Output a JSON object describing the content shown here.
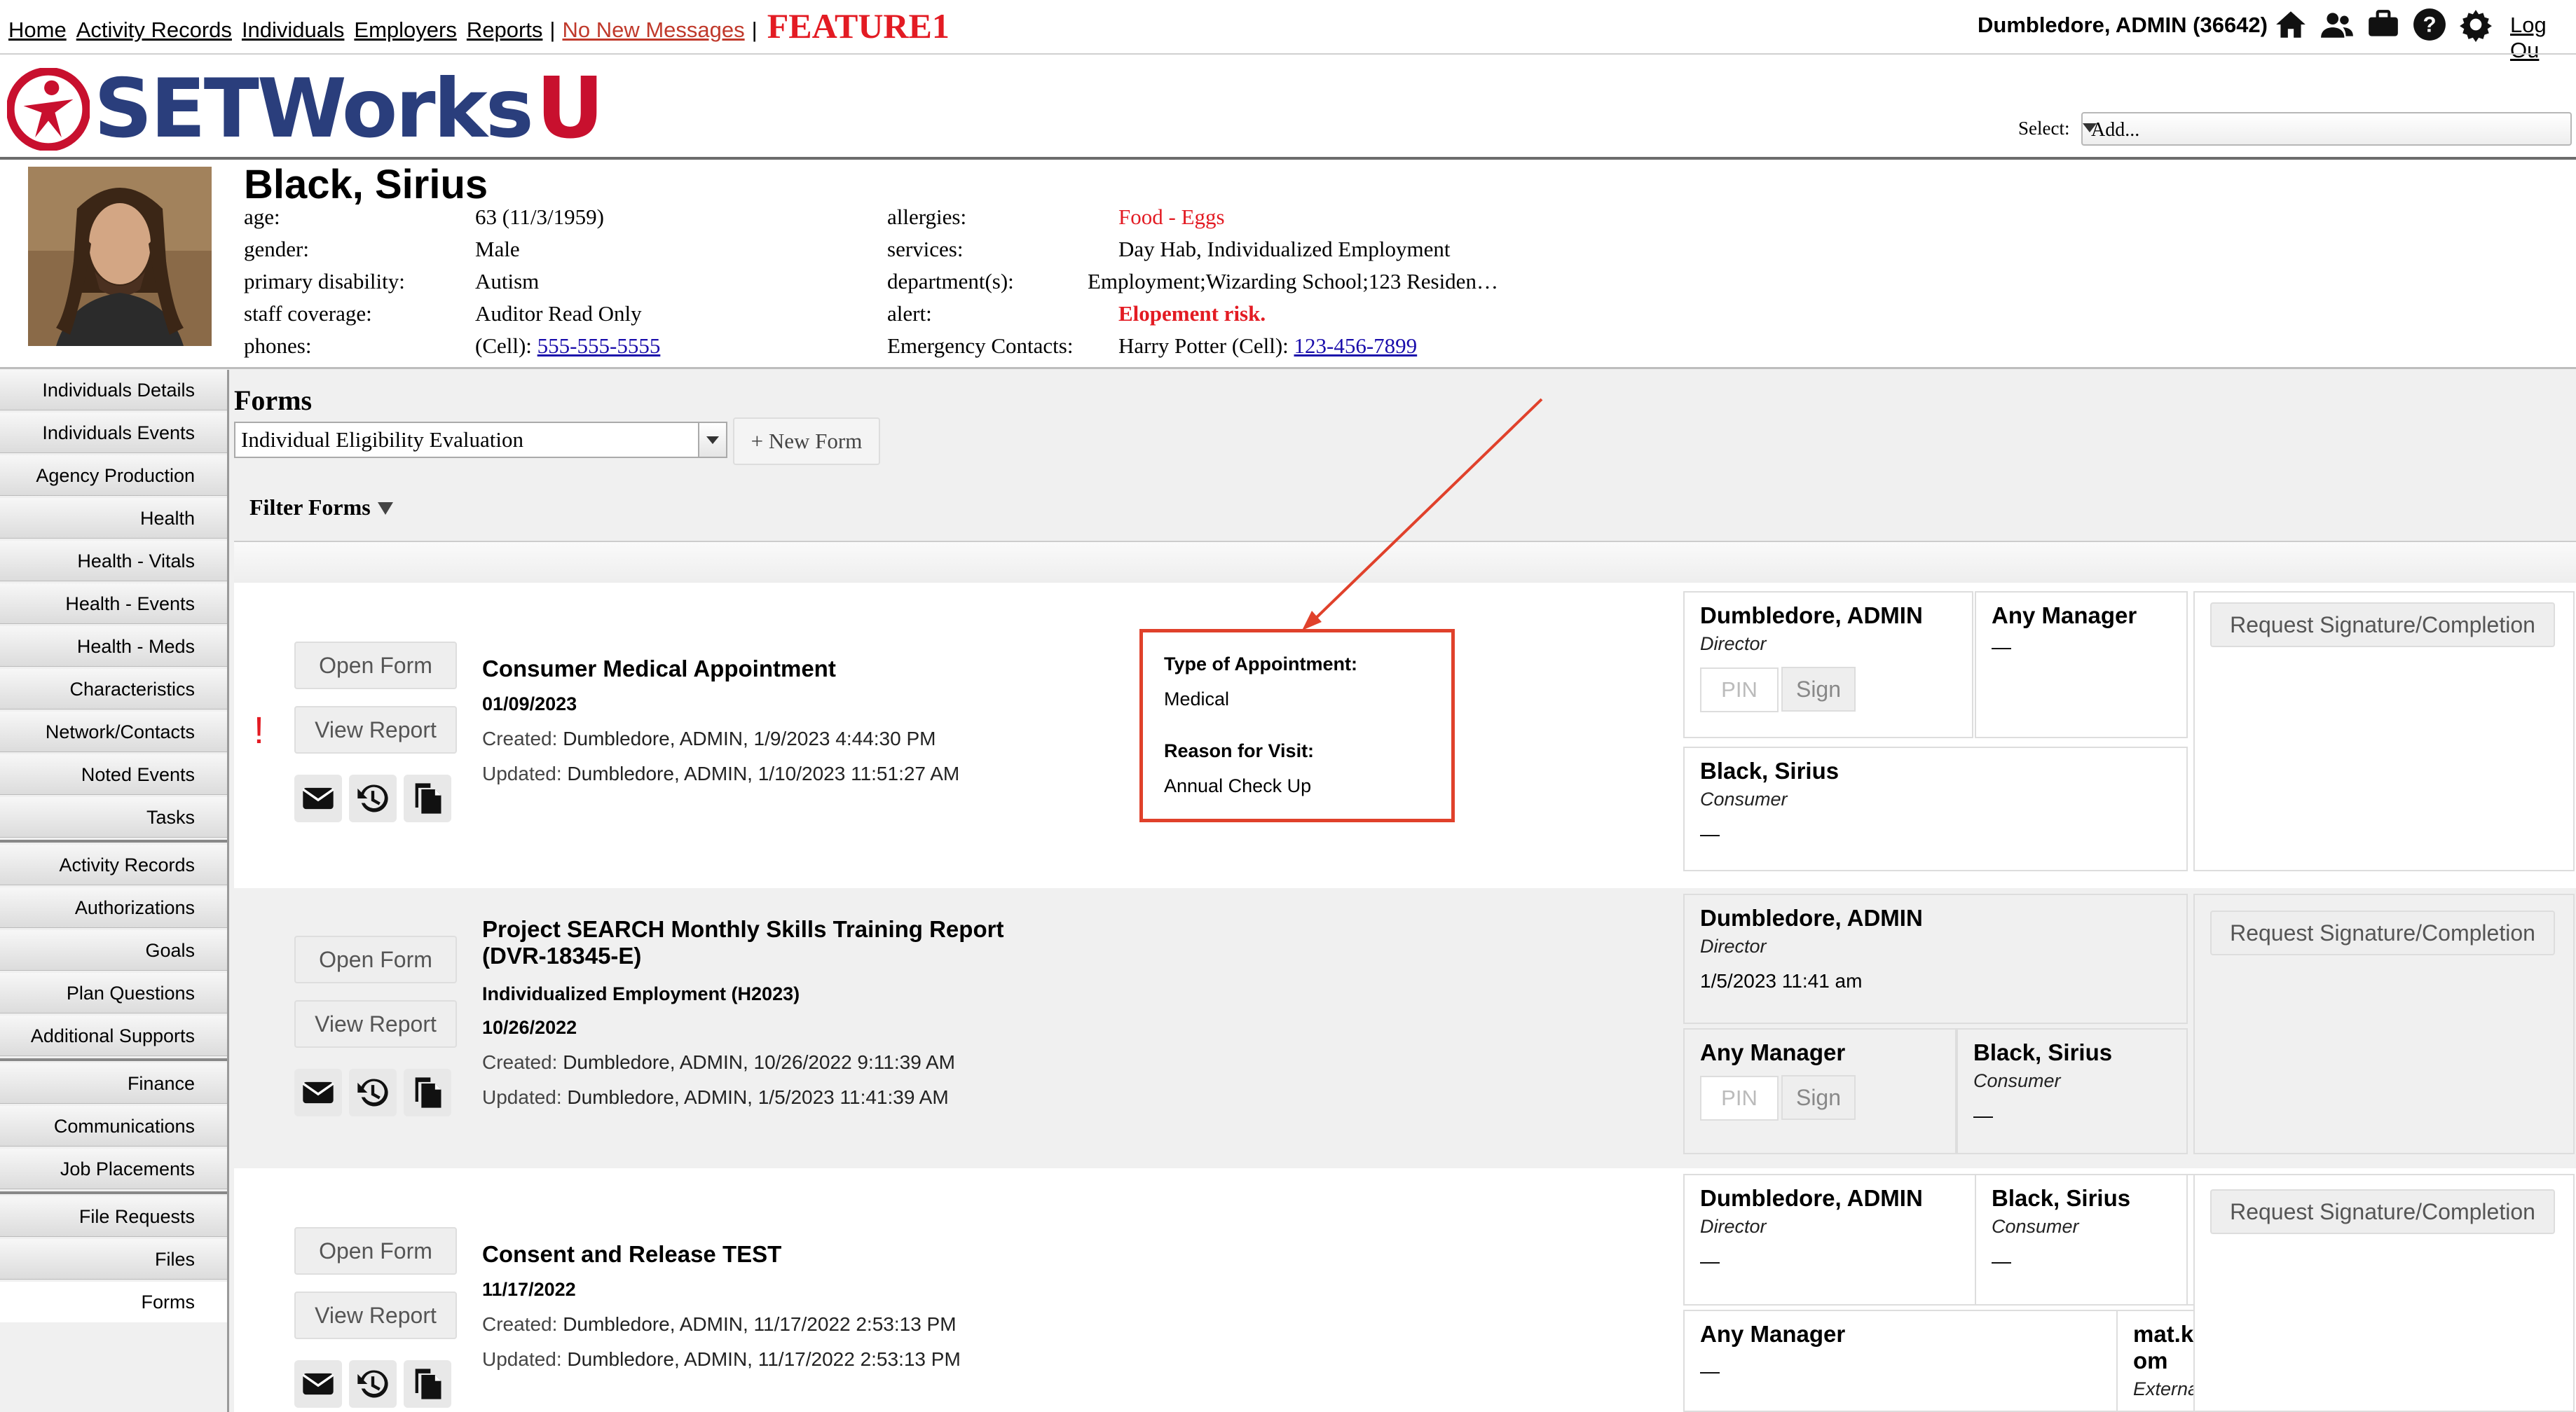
{
  "topnav": {
    "links": [
      "Home",
      "Activity Records",
      "Individuals",
      "Employers",
      "Reports"
    ],
    "messages": "No New Messages",
    "sep": "|",
    "feature": "FEATURE1",
    "user": "Dumbledore, ADMIN  (36642)",
    "logout": "Log Ou",
    "icons": [
      "home-icon",
      "users-icon",
      "briefcase-icon",
      "help-icon",
      "gear-icon"
    ]
  },
  "logo": {
    "text": "SETWorks",
    "accent": "U"
  },
  "select": {
    "label": "Select:",
    "value": "Add..."
  },
  "profile": {
    "name": "Black, Sirius",
    "left": [
      {
        "k": "age:",
        "v": "63 (11/3/1959)"
      },
      {
        "k": "gender:",
        "v": "Male"
      },
      {
        "k": "primary disability:",
        "v": "Autism"
      },
      {
        "k": "staff coverage:",
        "v": "Auditor Read Only"
      },
      {
        "k": "phones:",
        "v": "(Cell): ",
        "link": "555-555-5555"
      }
    ],
    "right": [
      {
        "k": "allergies:",
        "v": "Food - Eggs"
      },
      {
        "k": "services:",
        "v": "Day Hab, Individualized Employment"
      },
      {
        "k": "department(s):",
        "v": "Employment;Wizarding School;123 Residen…"
      },
      {
        "k": "alert:",
        "v": "Elopement risk."
      },
      {
        "k": "Emergency Contacts:",
        "v": "Harry Potter (Cell): ",
        "link": "123-456-7899"
      }
    ]
  },
  "sidebar": [
    "Individuals Details",
    "Individuals Events",
    "Agency Production",
    "Health",
    "Health - Vitals",
    "Health - Events",
    "Health - Meds",
    "Characteristics",
    "Network/Contacts",
    "Noted Events",
    "Tasks",
    "Activity Records",
    "Authorizations",
    "Goals",
    "Plan Questions",
    "Additional Supports",
    "Finance",
    "Communications",
    "Job Placements",
    "File Requests",
    "Files",
    "Forms"
  ],
  "forms": {
    "title": "Forms",
    "selected_form": "Individual Eligibility Evaluation",
    "new_form": "+ New Form",
    "filter": "Filter Forms",
    "open_label": "Open Form",
    "view_label": "View Report",
    "request_label": "Request Signature/Completion",
    "pin_placeholder": "PIN",
    "sign_label": "Sign",
    "rows": [
      {
        "title": "Consumer Medical Appointment",
        "subtitle": "",
        "date": "01/09/2023",
        "created_k": "Created:",
        "created": "Dumbledore, ADMIN, 1/9/2023 4:44:30 PM",
        "updated_k": "Updated:",
        "updated": "Dumbledore, ADMIN, 1/10/2023 11:51:27 AM",
        "flag": "!",
        "signers": [
          {
            "name": "Dumbledore, ADMIN",
            "role": "Director",
            "detail": ""
          },
          {
            "name": "Any Manager",
            "role": "",
            "detail": "—"
          },
          {
            "name": "Black, Sirius",
            "role": "Consumer",
            "detail": "—"
          }
        ]
      },
      {
        "title": "Project SEARCH Monthly Skills Training Report",
        "title2": "(DVR-18345-E)",
        "subtitle": "Individualized Employment (H2023)",
        "date": "10/26/2022",
        "created_k": "Created:",
        "created": "Dumbledore, ADMIN, 10/26/2022 9:11:39 AM",
        "updated_k": "Updated:",
        "updated": "Dumbledore, ADMIN, 1/5/2023 11:41:39 AM",
        "signers": [
          {
            "name": "Dumbledore, ADMIN",
            "role": "Director",
            "detail": "1/5/2023 11:41 am"
          },
          {
            "name": "Any Manager",
            "role": "",
            "detail": ""
          },
          {
            "name": "Black, Sirius",
            "role": "Consumer",
            "detail": "—"
          }
        ]
      },
      {
        "title": "Consent and Release TEST",
        "date": "11/17/2022",
        "created_k": "Created:",
        "created": "Dumbledore, ADMIN, 11/17/2022 2:53:13 PM",
        "updated_k": "Updated:",
        "updated": "Dumbledore, ADMIN, 11/17/2022 2:53:13 PM",
        "signers": [
          {
            "name": "Dumbledore, ADMIN",
            "role": "Director",
            "detail": "—"
          },
          {
            "name": "Black, Sirius",
            "role": "Consumer",
            "detail": "—"
          },
          {
            "name": "Any Manager",
            "role": "",
            "detail": "—"
          },
          {
            "name": "mat.koelling@gmail.c",
            "name2": "om",
            "role": "External User",
            "detail": ""
          }
        ]
      }
    ]
  },
  "callout": {
    "label1": "Type of Appointment:",
    "value1": "Medical",
    "label2": "Reason for Visit:",
    "value2": "Annual Check Up"
  },
  "colors": {
    "accent_red": "#e31b23",
    "brand_blue": "#2a3e7c",
    "annotation": "#e0412b"
  }
}
